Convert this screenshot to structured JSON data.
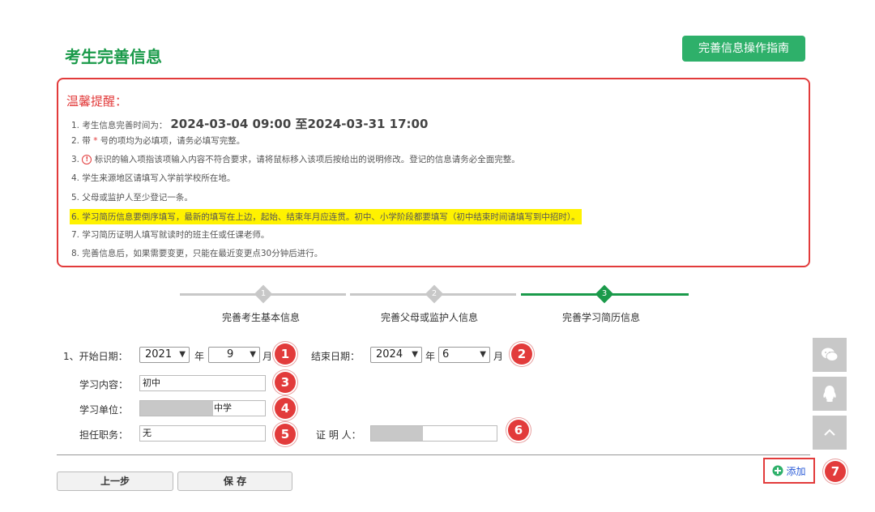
{
  "header": {
    "title": "考生完善信息",
    "guide_button": "完善信息操作指南"
  },
  "notice": {
    "title": "温馨提醒：",
    "item1_prefix": "1. 考生信息完善时间为：",
    "item1_time": "2024-03-04 09:00 至2024-03-31 17:00",
    "item2_a": "2. 带",
    "item2_star": "*",
    "item2_b": "号的项均为必填项，请务必填写完整。",
    "item3_prefix": "3.",
    "item3_icon": "!",
    "item3_text": "标识的输入项指该项输入内容不符合要求，请将鼠标移入该项后按给出的说明修改。登记的信息请务必全面完整。",
    "item4": "4. 学生来源地区请填写入学前学校所在地。",
    "item5": "5. 父母或监护人至少登记一条。",
    "item6": "6. 学习简历信息要倒序填写，最新的填写在上边，起始、结束年月应连贯。初中、小学阶段都要填写（初中结束时间请填写到中招时）。",
    "item7": "7. 学习简历证明人填写就读时的班主任或任课老师。",
    "item8": "8. 完善信息后，如果需要变更，只能在最近变更点30分钟后进行。"
  },
  "steps": [
    {
      "num": "1",
      "label": "完善考生基本信息"
    },
    {
      "num": "2",
      "label": "完善父母或监护人信息"
    },
    {
      "num": "3",
      "label": "完善学习简历信息"
    }
  ],
  "form": {
    "row_prefix": "1、开始日期：",
    "start_year": "2021",
    "year_unit": "年",
    "start_month": "9",
    "month_unit": "月",
    "end_label": "结束日期：",
    "end_year": "2024",
    "end_month": "6",
    "content_label": "学习内容：",
    "content_value": "初中",
    "unit_label": "学习单位：",
    "unit_value": "中学",
    "position_label": "担任职务：",
    "position_value": "无",
    "witness_label": "证 明 人："
  },
  "badges": [
    "1",
    "2",
    "3",
    "4",
    "5",
    "6",
    "7"
  ],
  "buttons": {
    "prev": "上一步",
    "save": "保 存",
    "add": "添加"
  },
  "side_tools": [
    "wechat-icon",
    "qq-icon",
    "back-to-top-icon"
  ],
  "colors": {
    "brand_green": "#2eb06a",
    "alert_red": "#e23b3b",
    "highlight": "#fff200"
  }
}
